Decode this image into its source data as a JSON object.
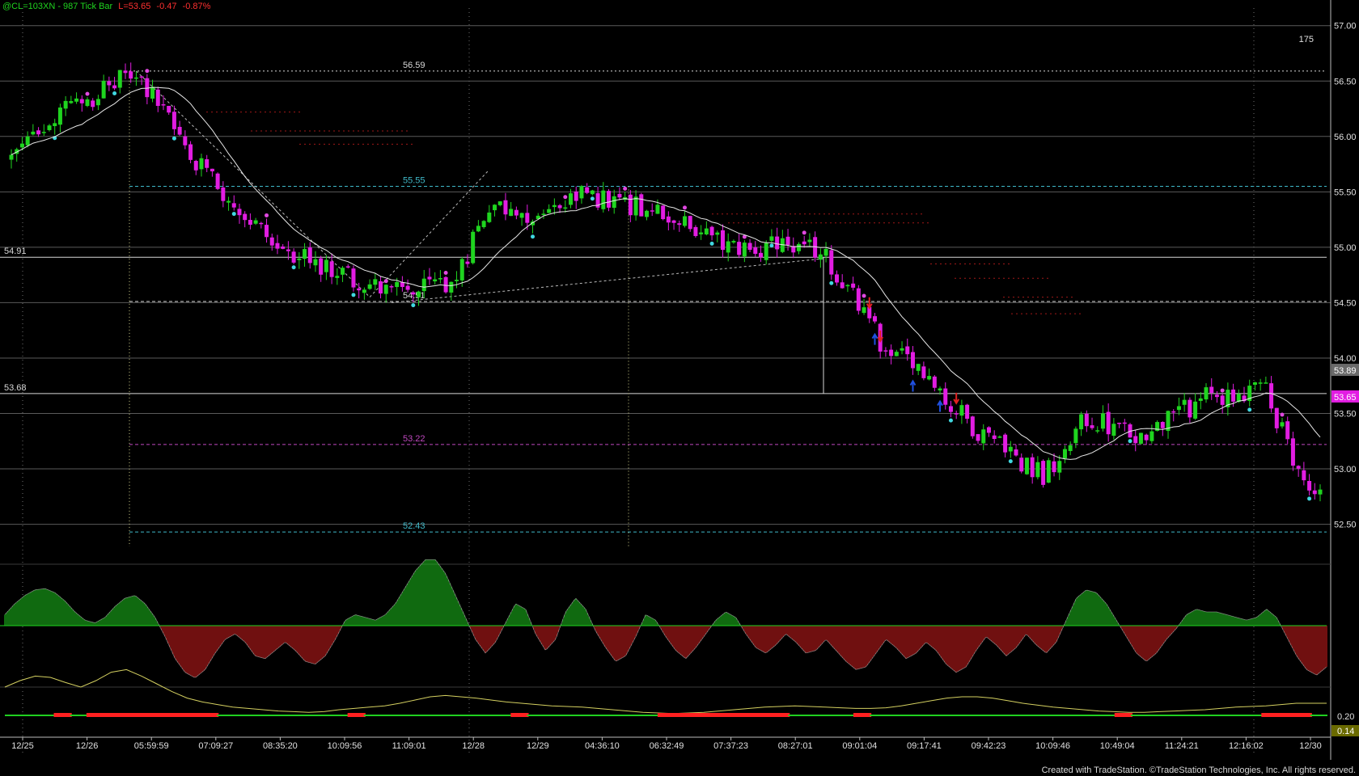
{
  "header": {
    "symbol": "@CL=103XN - 987 Tick Bar",
    "last": "L=53.65",
    "change": "-0.47",
    "change_pct": "-0.87%"
  },
  "footer": {
    "credit": "Created with TradeStation. ©TradeStation Technologies, Inc. All rights reserved."
  },
  "colors": {
    "background": "#000000",
    "grid": "#5a5a5a",
    "up": "#1fd41f",
    "down": "#e21de2",
    "ma": "#e8e8e8",
    "osc_pos": "#1fd41f",
    "osc_neg": "#e02020",
    "osc_line_pos": "#1fd41f",
    "osc_line_neg": "#d01818",
    "lower_line": "#d4d060",
    "squeeze_on": "#ff2020",
    "squeeze_off": "#20d020",
    "level_white": "#d8d8d8",
    "level_cyan": "#3fb8c8",
    "level_magenta": "#c048c0",
    "dot_high": "#e048e0",
    "dot_low": "#40d8e0",
    "arrow_down": "#e02020",
    "arrow_up": "#2050e0"
  },
  "chart_data": [
    {
      "type": "candlestick",
      "title": "@CL=103XN - 987 Tick Bar",
      "ylim": [
        52.3,
        57.1
      ],
      "y_ticks": [
        "57.00",
        "56.50",
        "56.00",
        "55.50",
        "55.00",
        "54.50",
        "54.00",
        "53.50",
        "53.00",
        "52.50"
      ],
      "x_tick_labels": [
        "12/25",
        "12/26",
        "05:59:59",
        "07:09:27",
        "08:35:20",
        "10:09:56",
        "11:09:01",
        "12/28",
        "12/29",
        "04:36:10",
        "06:32:49",
        "07:37:23",
        "08:27:01",
        "09:01:04",
        "09:17:41",
        "09:42:23",
        "10:09:46",
        "10:49:04",
        "11:24:21",
        "12:16:02",
        "12/30"
      ],
      "price_path_anchors": [
        {
          "bar": 0,
          "price": 55.8
        },
        {
          "bar": 10,
          "price": 56.25
        },
        {
          "bar": 18,
          "price": 56.45
        },
        {
          "bar": 23,
          "price": 56.6
        },
        {
          "bar": 34,
          "price": 55.75
        },
        {
          "bar": 48,
          "price": 55.05
        },
        {
          "bar": 62,
          "price": 54.75
        },
        {
          "bar": 70,
          "price": 54.58
        },
        {
          "bar": 82,
          "price": 54.72
        },
        {
          "bar": 88,
          "price": 55.4
        },
        {
          "bar": 96,
          "price": 55.3
        },
        {
          "bar": 105,
          "price": 55.45
        },
        {
          "bar": 116,
          "price": 55.38
        },
        {
          "bar": 132,
          "price": 55.0
        },
        {
          "bar": 148,
          "price": 54.98
        },
        {
          "bar": 151,
          "price": 54.85
        },
        {
          "bar": 160,
          "price": 54.15
        },
        {
          "bar": 168,
          "price": 53.82
        },
        {
          "bar": 178,
          "price": 53.35
        },
        {
          "bar": 190,
          "price": 52.95
        },
        {
          "bar": 198,
          "price": 53.45
        },
        {
          "bar": 208,
          "price": 53.3
        },
        {
          "bar": 220,
          "price": 53.65
        },
        {
          "bar": 231,
          "price": 53.75
        },
        {
          "bar": 236,
          "price": 53.05
        },
        {
          "bar": 241,
          "price": 52.75
        }
      ],
      "last_price": "53.65",
      "last_label_upper": "53.89",
      "bar_count_label": "175",
      "moving_average": true,
      "levels": [
        {
          "value": 56.59,
          "label": "56.59",
          "style": "dotted",
          "color": "white"
        },
        {
          "value": 55.55,
          "label": "55.55",
          "style": "dashed",
          "color": "cyan"
        },
        {
          "value": 54.91,
          "label": "54.91",
          "style": "solid",
          "color": "white"
        },
        {
          "value": 54.51,
          "label": "54.51",
          "style": "dashed",
          "color": "white"
        },
        {
          "value": 53.68,
          "label": "53.68",
          "style": "solid",
          "color": "white"
        },
        {
          "value": 53.22,
          "label": "53.22",
          "style": "dashed",
          "color": "magenta"
        },
        {
          "value": 52.43,
          "label": "52.43",
          "style": "dashed",
          "color": "cyan"
        }
      ],
      "arrows": [
        {
          "bar": 158,
          "dir": "down"
        },
        {
          "bar": 160,
          "dir": "down"
        },
        {
          "bar": 159,
          "dir": "up"
        },
        {
          "bar": 166,
          "dir": "up"
        },
        {
          "bar": 171,
          "dir": "up"
        },
        {
          "bar": 174,
          "dir": "down"
        }
      ],
      "grid": true
    },
    {
      "type": "histogram",
      "name": "momentum oscillator",
      "values": [
        0.4,
        0.8,
        1.1,
        1.3,
        1.35,
        1.2,
        0.9,
        0.5,
        0.2,
        0.1,
        0.3,
        0.7,
        1.0,
        1.1,
        0.8,
        0.3,
        -0.4,
        -1.2,
        -1.7,
        -1.9,
        -1.6,
        -1.0,
        -0.5,
        -0.3,
        -0.6,
        -1.1,
        -1.2,
        -0.9,
        -0.6,
        -0.9,
        -1.3,
        -1.4,
        -1.1,
        -0.5,
        0.2,
        0.4,
        0.3,
        0.2,
        0.4,
        0.8,
        1.4,
        2.0,
        2.4,
        2.4,
        1.9,
        1.1,
        0.3,
        -0.5,
        -1.0,
        -0.6,
        0.1,
        0.8,
        0.6,
        -0.3,
        -0.9,
        -0.5,
        0.5,
        1.0,
        0.6,
        -0.2,
        -0.8,
        -1.3,
        -1.1,
        -0.4,
        0.4,
        0.2,
        -0.4,
        -0.9,
        -1.2,
        -0.8,
        -0.3,
        0.2,
        0.5,
        0.3,
        -0.3,
        -0.8,
        -1.0,
        -0.7,
        -0.3,
        -0.6,
        -1.0,
        -0.9,
        -0.5,
        -0.9,
        -1.3,
        -1.6,
        -1.5,
        -1.0,
        -0.5,
        -0.8,
        -1.2,
        -1.0,
        -0.6,
        -0.9,
        -1.4,
        -1.7,
        -1.5,
        -0.9,
        -0.4,
        -0.7,
        -1.1,
        -0.8,
        -0.3,
        -0.7,
        -1.0,
        -0.6,
        0.2,
        1.0,
        1.3,
        1.2,
        0.8,
        0.2,
        -0.4,
        -1.0,
        -1.3,
        -1.0,
        -0.5,
        -0.1,
        0.4,
        0.6,
        0.5,
        0.5,
        0.4,
        0.3,
        0.2,
        0.3,
        0.6,
        0.3,
        -0.4,
        -1.1,
        -1.6,
        -1.8,
        -1.5
      ]
    },
    {
      "type": "line",
      "name": "lower indicator",
      "value_labels": [
        "0.20",
        "0.14"
      ],
      "values": [
        0.45,
        0.55,
        0.62,
        0.6,
        0.52,
        0.45,
        0.55,
        0.68,
        0.72,
        0.62,
        0.5,
        0.38,
        0.28,
        0.22,
        0.18,
        0.14,
        0.12,
        0.1,
        0.08,
        0.07,
        0.06,
        0.07,
        0.1,
        0.12,
        0.14,
        0.16,
        0.2,
        0.25,
        0.3,
        0.32,
        0.3,
        0.28,
        0.25,
        0.22,
        0.2,
        0.18,
        0.16,
        0.15,
        0.14,
        0.12,
        0.1,
        0.08,
        0.06,
        0.05,
        0.04,
        0.05,
        0.06,
        0.08,
        0.1,
        0.12,
        0.14,
        0.15,
        0.16,
        0.15,
        0.14,
        0.13,
        0.12,
        0.12,
        0.13,
        0.16,
        0.2,
        0.24,
        0.28,
        0.3,
        0.3,
        0.28,
        0.24,
        0.2,
        0.17,
        0.14,
        0.12,
        0.1,
        0.08,
        0.07,
        0.06,
        0.06,
        0.07,
        0.08,
        0.09,
        0.1,
        0.12,
        0.14,
        0.15,
        0.16,
        0.18,
        0.2,
        0.2,
        0.2
      ],
      "squeeze_dots": "20 per segment: 1=red, 0=green",
      "squeeze_pattern": [
        0,
        0,
        0,
        1,
        0,
        1,
        1,
        1,
        1,
        1,
        1,
        1,
        1,
        0,
        0,
        0,
        0,
        0,
        0,
        0,
        0,
        1,
        0,
        0,
        0,
        0,
        0,
        0,
        0,
        0,
        0,
        1,
        0,
        0,
        0,
        0,
        0,
        0,
        0,
        0,
        1,
        1,
        1,
        1,
        1,
        1,
        1,
        1,
        0,
        0,
        0,
        0,
        1,
        0,
        0,
        0,
        0,
        0,
        0,
        0,
        0,
        0,
        0,
        0,
        0,
        0,
        0,
        0,
        1,
        0,
        0,
        0,
        0,
        0,
        0,
        0,
        0,
        1,
        1,
        1,
        0
      ]
    }
  ]
}
